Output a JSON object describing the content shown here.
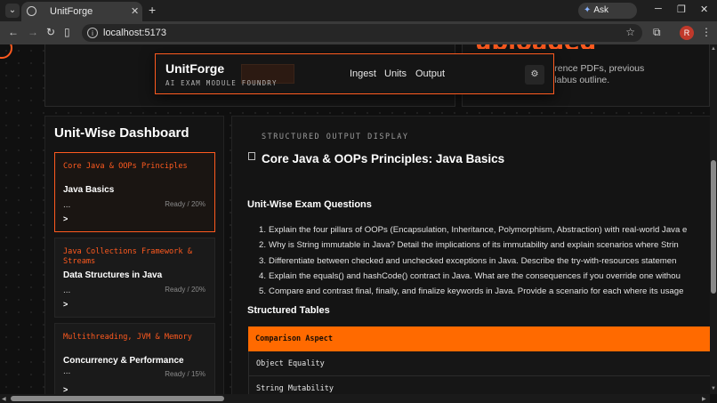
{
  "browser": {
    "tab_title": "UnitForge",
    "url": "localhost:5173",
    "gemini_label": "Ask Gemini",
    "profile_initial": "R"
  },
  "hero": {
    "heading_fragment": "uploaded",
    "description": "Lecture decks, reference PDFs, previous question banks, syllabus outline."
  },
  "navbar": {
    "brand": "UnitForge",
    "tagline": "AI EXAM MODULE FOUNDRY",
    "links": [
      "Ingest",
      "Units",
      "Output"
    ]
  },
  "sidebar": {
    "title": "Unit-Wise Dashboard",
    "units": [
      {
        "category": "Core Java & OOPs Principles",
        "title": "Java Basics",
        "status": "Ready / 20%",
        "active": true
      },
      {
        "category": "Java Collections Framework & Streams",
        "title": "Data Structures in Java",
        "status": "Ready / 20%",
        "active": false
      },
      {
        "category": "Multithreading, JVM & Memory",
        "title": "Concurrency & Performance",
        "status": "Ready / 15%",
        "active": false
      }
    ],
    "ellipsis": "...",
    "arrow": ">"
  },
  "main": {
    "eyebrow": "STRUCTURED OUTPUT DISPLAY",
    "title": "Core Java & OOPs Principles: Java Basics",
    "questions_heading": "Unit-Wise Exam Questions",
    "questions": [
      "Explain the four pillars of OOPs (Encapsulation, Inheritance, Polymorphism, Abstraction) with real-world Java e",
      "Why is String immutable in Java? Detail the implications of its immutability and explain scenarios where Strin",
      "Differentiate between checked and unchecked exceptions in Java. Describe the try-with-resources statemen",
      "Explain the equals() and hashCode() contract in Java. What are the consequences if you override one withou",
      "Compare and contrast final, finally, and finalize keywords in Java. Provide a scenario for each where its usage"
    ],
    "tables_heading": "Structured Tables",
    "table_header": "Comparison Aspect",
    "table_rows": [
      "Object Equality",
      "String Mutability"
    ]
  },
  "colors": {
    "accent": "#ff5a1f",
    "table_header": "#ff6a00",
    "background": "#101010"
  }
}
